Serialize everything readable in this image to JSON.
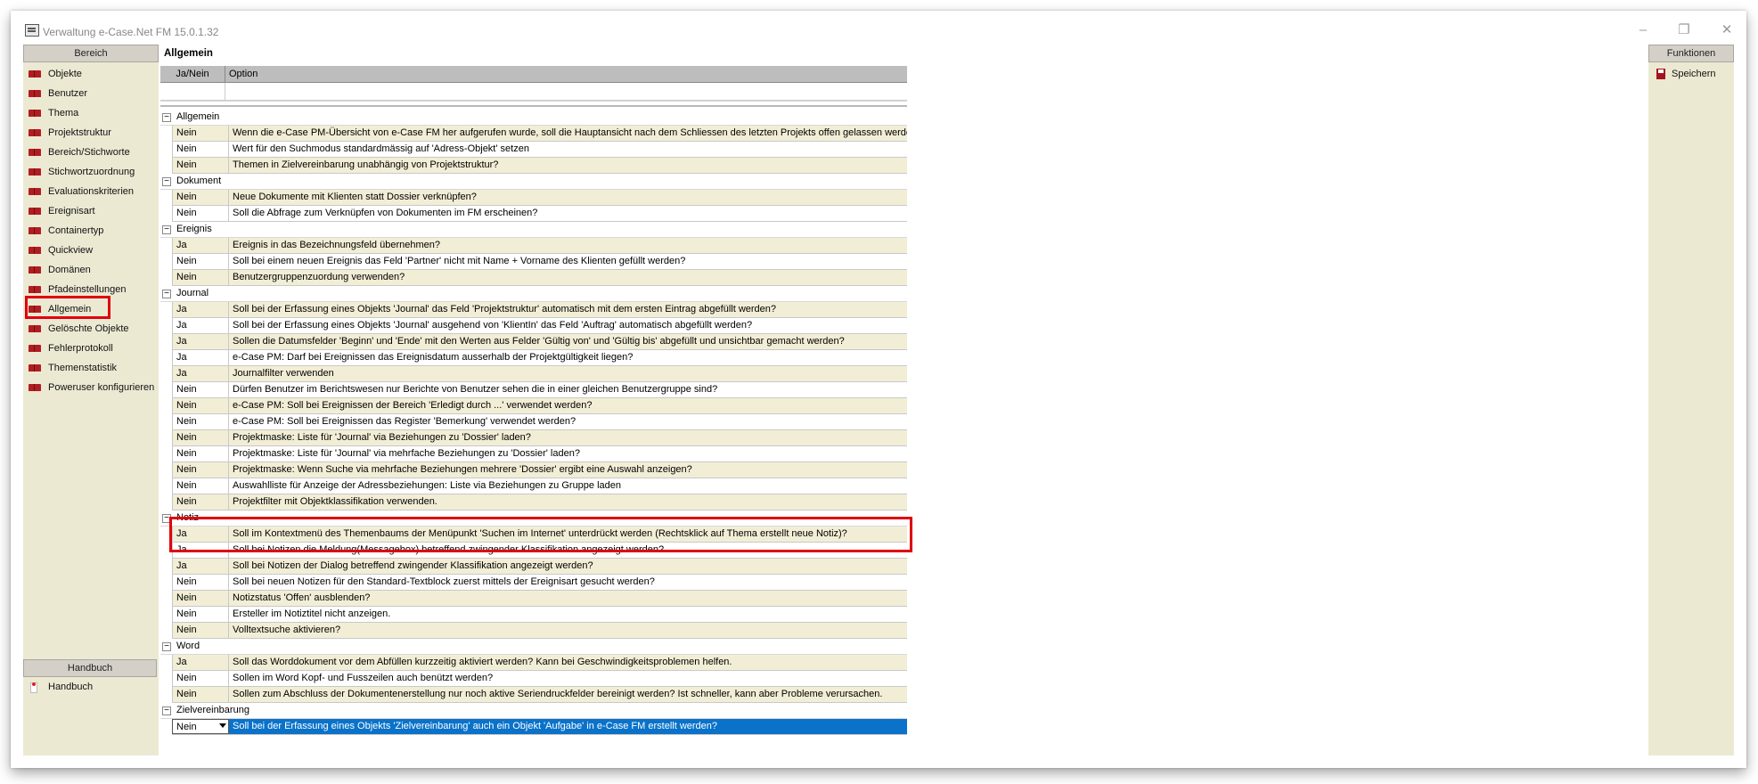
{
  "window": {
    "title": "Verwaltung e-Case.Net FM 15.0.1.32",
    "min": "–",
    "restore": "❐",
    "close": "✕"
  },
  "left_panel": {
    "header": "Bereich",
    "items": [
      "Objekte",
      "Benutzer",
      "Thema",
      "Projektstruktur",
      "Bereich/Stichworte",
      "Stichwortzuordnung",
      "Evaluationskriterien",
      "Ereignisart",
      "Containertyp",
      "Quickview",
      "Domänen",
      "Pfadeinstellungen",
      "Allgemein",
      "Gelöschte Objekte",
      "Fehlerprotokoll",
      "Themenstatistik",
      "Poweruser konfigurieren"
    ],
    "selected": "Allgemein",
    "handbuch_header": "Handbuch",
    "handbuch_item": "Handbuch"
  },
  "right_panel": {
    "header": "Funktionen",
    "save_label": "Speichern"
  },
  "main": {
    "title": "Allgemein",
    "columns": [
      "Ja/Nein",
      "Option"
    ],
    "groups": [
      {
        "name": "Allgemein",
        "rows": [
          [
            "Nein",
            "Wenn die e-Case PM-Übersicht von e-Case FM her aufgerufen wurde, soll die Hauptansicht nach dem Schliessen des letzten Projekts offen gelassen werden?"
          ],
          [
            "Nein",
            "Wert für den Suchmodus standardmässig auf 'Adress-Objekt' setzen"
          ],
          [
            "Nein",
            "Themen in Zielvereinbarung unabhängig von Projektstruktur?"
          ]
        ]
      },
      {
        "name": "Dokument",
        "rows": [
          [
            "Nein",
            "Neue Dokumente mit Klienten statt Dossier verknüpfen?"
          ],
          [
            "Nein",
            "Soll die Abfrage zum Verknüpfen von Dokumenten im FM erscheinen?"
          ]
        ]
      },
      {
        "name": "Ereignis",
        "rows": [
          [
            "Ja",
            "Ereignis in das Bezeichnungsfeld übernehmen?"
          ],
          [
            "Nein",
            "Soll bei einem neuen Ereignis das Feld 'Partner' nicht mit Name + Vorname des Klienten gefüllt werden?"
          ],
          [
            "Nein",
            "Benutzergruppenzuordung verwenden?"
          ]
        ]
      },
      {
        "name": "Journal",
        "rows": [
          [
            "Ja",
            "Soll bei der Erfassung eines Objekts 'Journal' das Feld 'Projektstruktur' automatisch mit dem ersten Eintrag abgefüllt werden?"
          ],
          [
            "Ja",
            "Soll bei der Erfassung eines Objekts 'Journal' ausgehend von 'KlientIn' das Feld 'Auftrag' automatisch abgefüllt werden?"
          ],
          [
            "Ja",
            "Sollen die Datumsfelder 'Beginn' und 'Ende' mit den Werten aus Felder 'Gültig von' und 'Gültig bis' abgefüllt und unsichtbar gemacht werden?"
          ],
          [
            "Ja",
            "e-Case PM: Darf bei Ereignissen das Ereignisdatum ausserhalb der Projektgültigkeit liegen?"
          ],
          [
            "Ja",
            "Journalfilter verwenden"
          ],
          [
            "Nein",
            "Dürfen Benutzer im Berichtswesen nur Berichte von Benutzer sehen die in einer gleichen Benutzergruppe sind?"
          ],
          [
            "Nein",
            "e-Case PM: Soll bei Ereignissen der Bereich 'Erledigt durch ...' verwendet werden?"
          ],
          [
            "Nein",
            "e-Case PM: Soll bei Ereignissen das Register 'Bemerkung' verwendet werden?"
          ],
          [
            "Nein",
            "Projektmaske: Liste für 'Journal' via Beziehungen zu 'Dossier' laden?"
          ],
          [
            "Nein",
            "Projektmaske: Liste für 'Journal' via mehrfache Beziehungen zu 'Dossier' laden?"
          ],
          [
            "Nein",
            "Projektmaske: Wenn Suche via mehrfache Beziehungen mehrere 'Dossier' ergibt eine Auswahl anzeigen?"
          ],
          [
            "Nein",
            "Auswahlliste für Anzeige der Adressbeziehungen: Liste via Beziehungen zu Gruppe laden"
          ],
          [
            "Nein",
            "Projektfilter mit Objektklassifikation verwenden."
          ]
        ]
      },
      {
        "name": "Notiz",
        "rows": [
          [
            "Ja",
            "Soll im Kontextmenü des Themenbaums der Menüpunkt 'Suchen im Internet' unterdrückt werden (Rechtsklick auf Thema erstellt neue Notiz)?"
          ],
          [
            "Ja",
            "Soll bei Notizen die Meldung(Messagebox) betreffend zwingender Klassifikation angezeigt werden?"
          ],
          [
            "Ja",
            "Soll bei Notizen der Dialog betreffend zwingender Klassifikation angezeigt werden?"
          ],
          [
            "Nein",
            "Soll bei neuen Notizen für den Standard-Textblock zuerst mittels der Ereignisart gesucht werden?"
          ],
          [
            "Nein",
            "Notizstatus 'Offen' ausblenden?"
          ],
          [
            "Nein",
            "Ersteller im Notiztitel nicht anzeigen."
          ],
          [
            "Nein",
            "Volltextsuche aktivieren?"
          ]
        ]
      },
      {
        "name": "Word",
        "rows": [
          [
            "Ja",
            "Soll das Worddokument vor dem Abfüllen kurzzeitig aktiviert werden? Kann bei Geschwindigkeitsproblemen helfen."
          ],
          [
            "Nein",
            "Sollen im Word Kopf- und Fusszeilen auch benützt werden?"
          ],
          [
            "Nein",
            "Sollen zum Abschluss der Dokumentenerstellung nur noch aktive Seriendruckfelder bereinigt werden? Ist schneller, kann aber Probleme verursachen."
          ]
        ]
      },
      {
        "name": "Zielvereinbarung",
        "rows": [
          [
            "Nein",
            "Soll bei der Erfassung eines Objekts 'Zielvereinbarung' auch ein Objekt 'Aufgabe' in e-Case FM erstellt werden?"
          ]
        ]
      }
    ]
  }
}
